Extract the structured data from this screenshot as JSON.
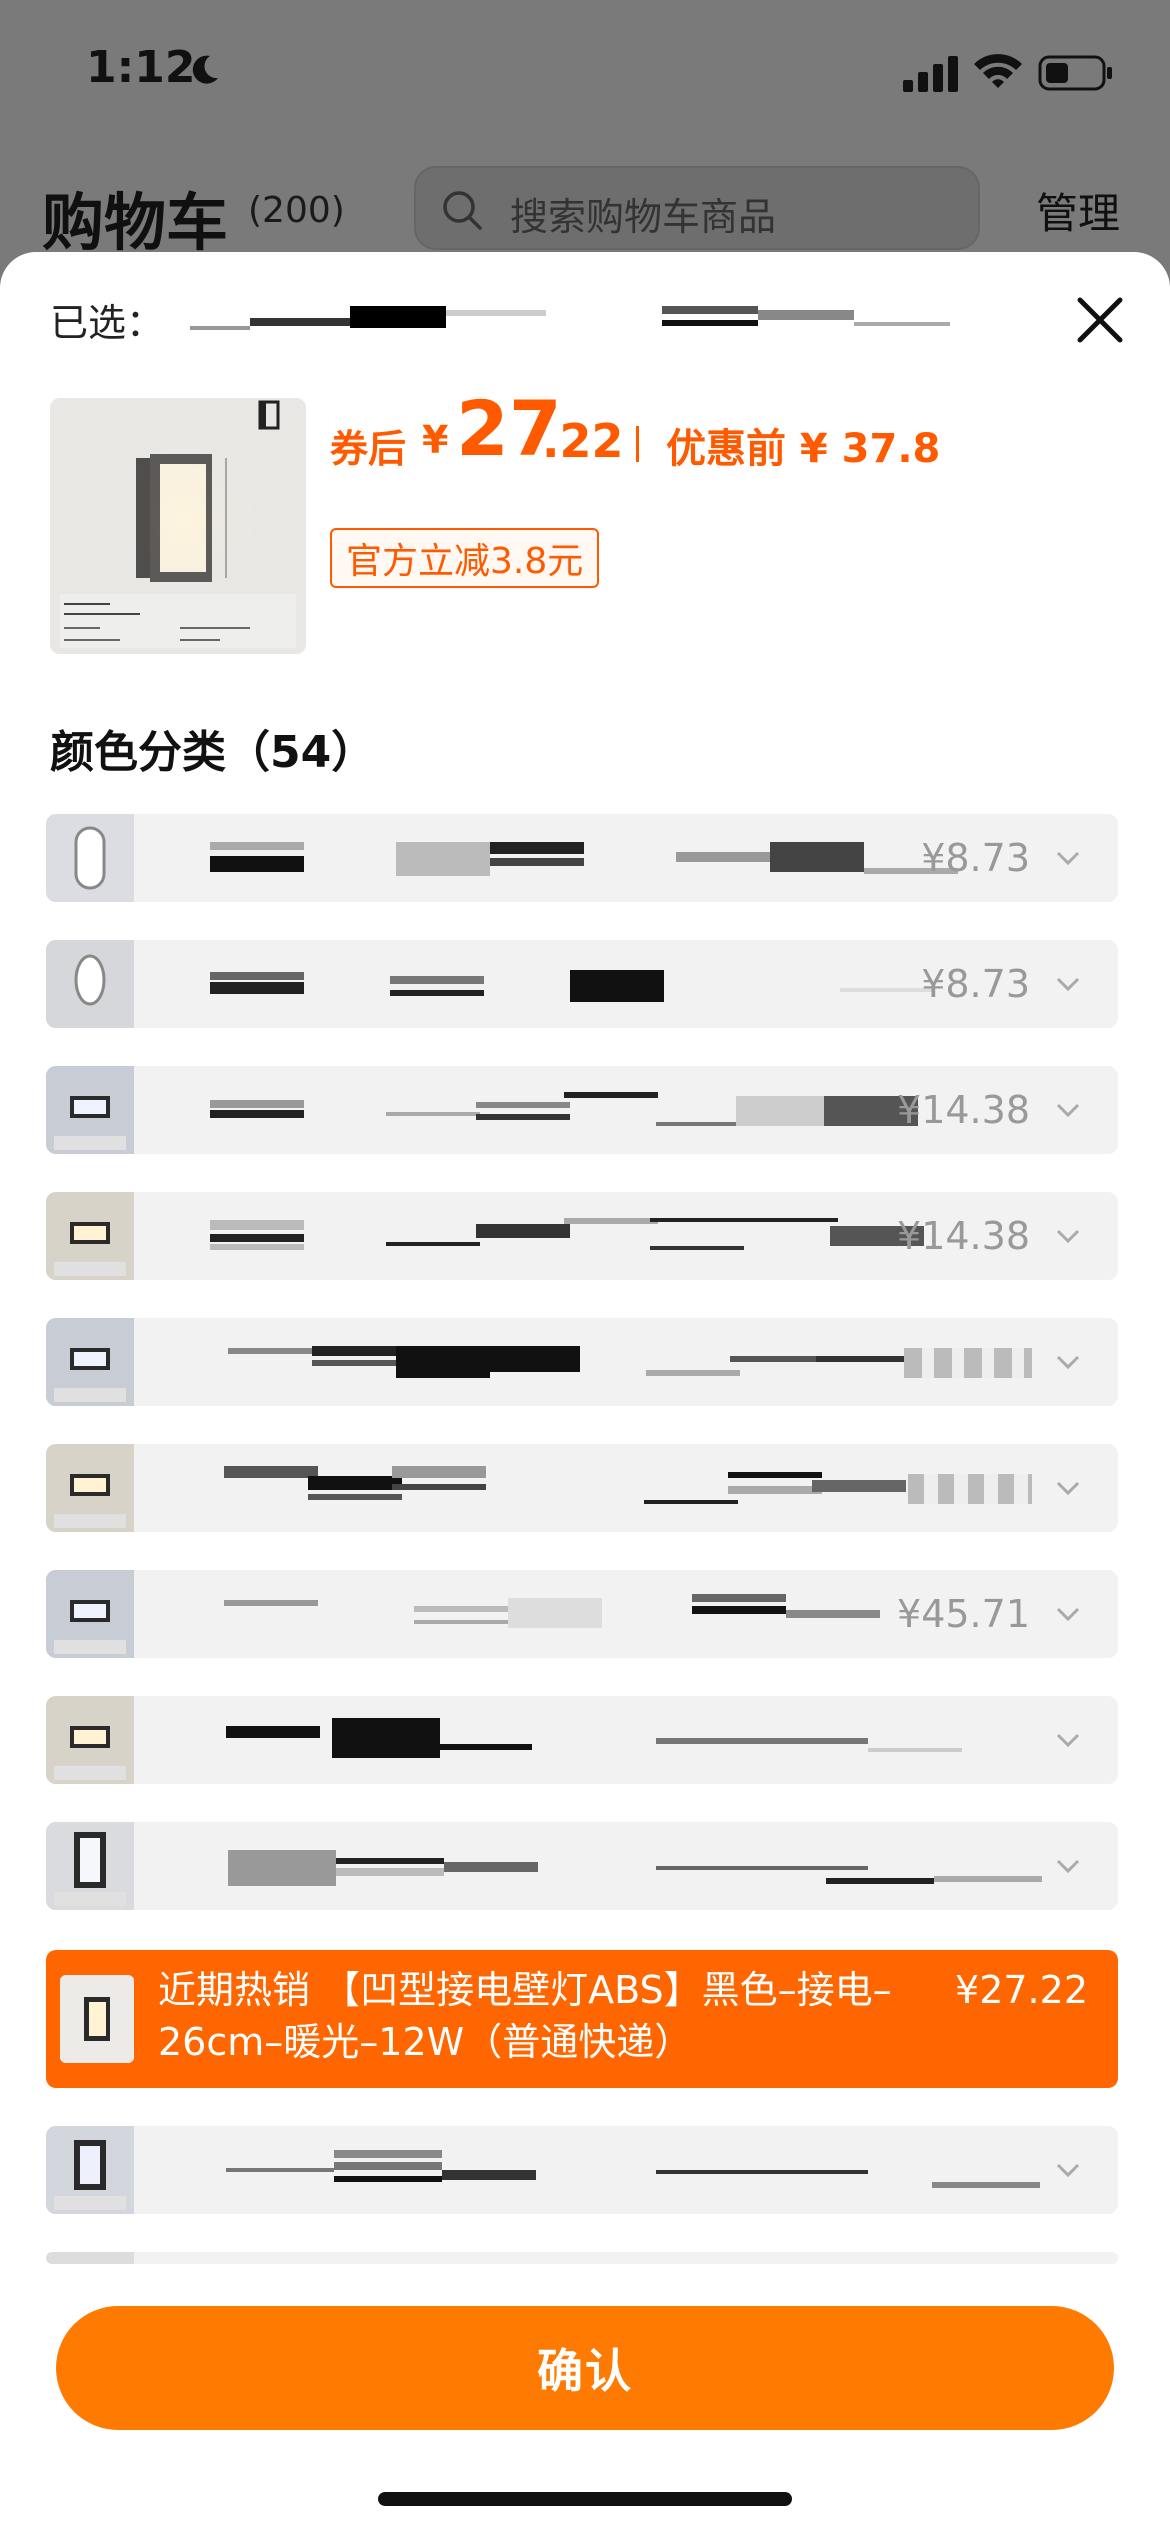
{
  "status_bar": {
    "time": "1:12"
  },
  "background": {
    "title": "购物车",
    "count": "(200)",
    "search_placeholder": "搜索购物车商品",
    "manage": "管理"
  },
  "sheet": {
    "selected_label": "已选：",
    "price": {
      "after_label": "券后",
      "yen": "¥",
      "int": "27",
      "dec": ".22",
      "before": "优惠前 ¥ 37.8"
    },
    "discount_tag": "官方立减3.8元",
    "section_title": "颜色分类（54）",
    "variants": [
      {
        "price": "¥8.73"
      },
      {
        "price": "¥8.73"
      },
      {
        "price": "¥14.38"
      },
      {
        "price": "¥14.38"
      },
      {
        "price": ""
      },
      {
        "price": ""
      },
      {
        "price": "¥45.71"
      },
      {
        "price": ""
      },
      {
        "price": ""
      },
      {
        "active": true,
        "name": "近期热销 【凹型接电壁灯ABS】黑色–接电–26cm–暖光–12W（普通快递）",
        "price": "¥27.22"
      },
      {
        "price": ""
      }
    ],
    "confirm": "确认"
  },
  "colors": {
    "accent": "#ff6600",
    "price": "#ff5a00",
    "button": "#ff7a00"
  }
}
